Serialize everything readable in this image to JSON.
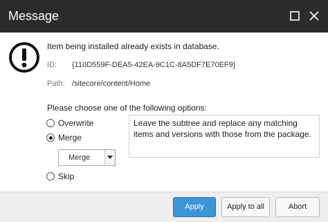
{
  "dialog": {
    "title": "Message",
    "message": "Item being installed already exists in database.",
    "id_label": "ID:",
    "id_value": "{110D559F-DEA5-42EA-9C1C-8A5DF7E70EF9}",
    "path_label": "Path:",
    "path_value": "/sitecore/content/Home",
    "prompt": "Please choose one of the following options:",
    "icon": "exclamation-circle-icon"
  },
  "options": [
    {
      "label": "Overwrite",
      "checked": false
    },
    {
      "label": "Merge",
      "checked": true
    },
    {
      "label": "Skip",
      "checked": false
    }
  ],
  "merge_select": {
    "selected": "Merge"
  },
  "description": "Leave the subtree and replace any matching items and versions with those from the package.",
  "buttons": {
    "apply": "Apply",
    "apply_all": "Apply to all",
    "abort": "Abort"
  },
  "colors": {
    "titlebar": "#2b2b2b",
    "primary_button": "#3d95d6",
    "footer": "#eeeeee"
  }
}
